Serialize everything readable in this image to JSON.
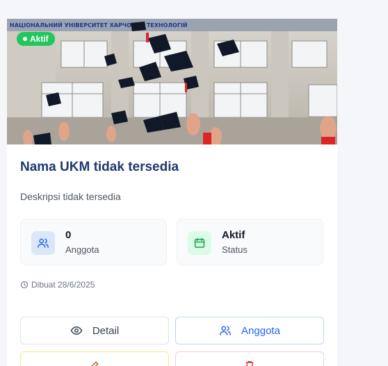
{
  "card": {
    "status_badge": "Aktif",
    "title": "Nama UKM tidak tersedia",
    "description": "Deskripsi tidak tersedia",
    "stats": [
      {
        "value": "0",
        "label": "Anggota",
        "icon": "users-icon",
        "accent": "#2563eb"
      },
      {
        "value": "Aktif",
        "label": "Status",
        "icon": "calendar-icon",
        "accent": "#16a34a"
      }
    ],
    "created": "Dibuat 28/6/2025",
    "buttons": {
      "detail": "Detail",
      "members": "Anggota"
    },
    "hero_caption": "НАЦІОНАЛЬНИЙ УНІВЕРСИТЕТ ХАРЧОВИХ ТЕХНОЛОГІЙ"
  },
  "colors": {
    "badge": "#22c55e",
    "title": "#1e3a6e",
    "primary": "#2563eb"
  }
}
